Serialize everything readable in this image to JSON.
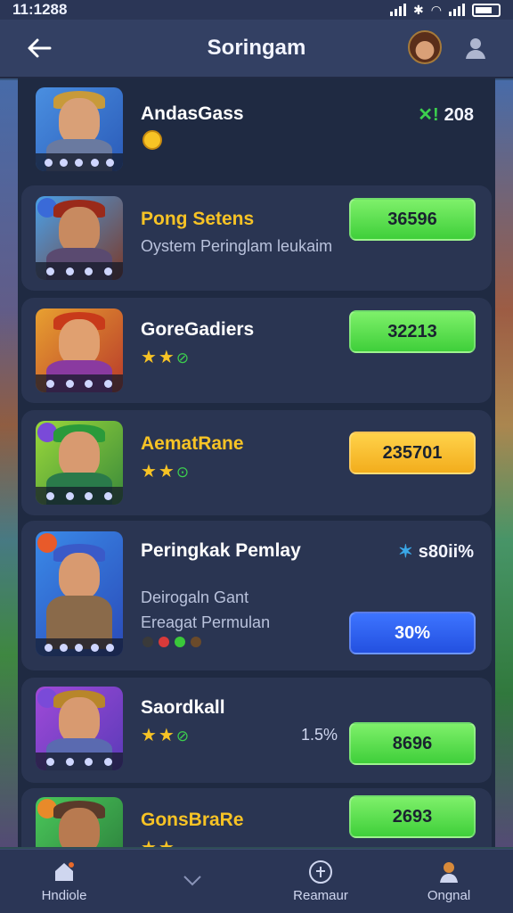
{
  "status": {
    "time": "11:1288"
  },
  "header": {
    "title": "Soringam"
  },
  "items": [
    {
      "name": "AndasGass",
      "name_color": "#ffffff",
      "score": "208",
      "score_icon": "✕!"
    },
    {
      "name": "Pong Setens",
      "name_color": "#f7c325",
      "subtitle": "Oystem Peringlam leukaim",
      "score": "36596"
    },
    {
      "name": "GoreGadiers",
      "name_color": "#ffffff",
      "score": "32213"
    },
    {
      "name": "AematRane",
      "name_color": "#f7c325",
      "score": "235701"
    },
    {
      "name": "Peringkak Pemlay",
      "subtitle_line1": "Deirogaln Gant",
      "subtitle_line2": "Ereagat Permulan",
      "stat": "s80ii%",
      "score": "30%"
    },
    {
      "name": "Saordkall",
      "name_color": "#ffffff",
      "side_stat": "1.5%",
      "score": "8696"
    },
    {
      "name": "GonsBraRe",
      "name_color": "#f7c325",
      "score": "2693"
    }
  ],
  "nav": [
    {
      "label": "Hndiole",
      "icon": "home-icon"
    },
    {
      "label": "",
      "icon": "chevron-down-icon"
    },
    {
      "label": "Reamaur",
      "icon": "add-circle-icon"
    },
    {
      "label": "Ongnal",
      "icon": "user-icon"
    }
  ]
}
